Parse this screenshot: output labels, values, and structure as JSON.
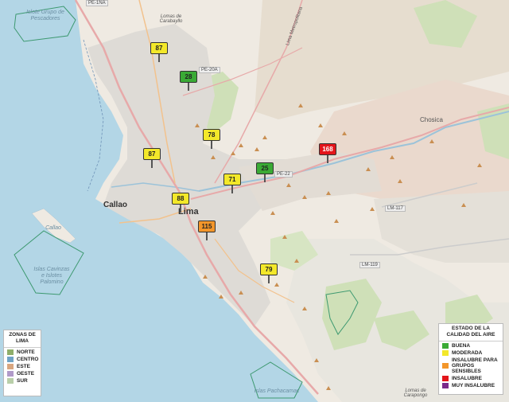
{
  "markers": [
    {
      "value": "87",
      "color": "#f3e82a",
      "status": "moderada"
    },
    {
      "value": "28",
      "color": "#3aaa35",
      "status": "buena"
    },
    {
      "value": "78",
      "color": "#f3e82a",
      "status": "moderada"
    },
    {
      "value": "87",
      "color": "#f3e82a",
      "status": "moderada"
    },
    {
      "value": "71",
      "color": "#f3e82a",
      "status": "moderada"
    },
    {
      "value": "25",
      "color": "#3aaa35",
      "status": "buena"
    },
    {
      "value": "168",
      "color": "#e3151b",
      "status": "insalubre"
    },
    {
      "value": "88",
      "color": "#f3e82a",
      "status": "moderada"
    },
    {
      "value": "115",
      "color": "#f3962a",
      "status": "insalubre para grupos sensibles"
    },
    {
      "value": "79",
      "color": "#f3e82a",
      "status": "moderada"
    }
  ],
  "zones_legend": {
    "title": "ZONAS DE LIMA",
    "items": [
      {
        "label": "NORTE",
        "color": "#8fae6a"
      },
      {
        "label": "CENTRO",
        "color": "#6fa3c6"
      },
      {
        "label": "ESTE",
        "color": "#d8a680"
      },
      {
        "label": "OESTE",
        "color": "#b09ac9"
      },
      {
        "label": "SUR",
        "color": "#b9cfa9"
      }
    ]
  },
  "quality_legend": {
    "title": "ESTADO DE LA CALIDAD DEL AIRE",
    "items": [
      {
        "label": "BUENA",
        "color": "#3aaa35"
      },
      {
        "label": "MODERADA",
        "color": "#f3e82a"
      },
      {
        "label": "INSALUBRE PARA GRUPOS SENSIBLES",
        "color": "#f3962a"
      },
      {
        "label": "INSALUBRE",
        "color": "#e3151b"
      },
      {
        "label": "MUY INSALUBRE",
        "color": "#7b2a8a"
      }
    ]
  },
  "map_labels": {
    "islote": "Islote Grupo de Pescadores",
    "islas_cavinzas": "Islas Cavinzas e Islotes Palomino",
    "islas_pachacamac": "Islas Pachacamac",
    "callao_island": "Callao",
    "callao_city": "Callao",
    "lima_city": "Lima",
    "chosica": "Chosica",
    "lomas_carabayllo": "Lomas de Carabayllo",
    "lomas_carapongo": "Lomas de Carapongo",
    "lima_metropolitana": "Lima Metropolitana"
  },
  "road_labels": {
    "pe1na": "PE-1NA",
    "pe20a": "PE-20A",
    "pe22": "PE-22",
    "lm117": "LM-117",
    "lm119": "LM-119"
  }
}
